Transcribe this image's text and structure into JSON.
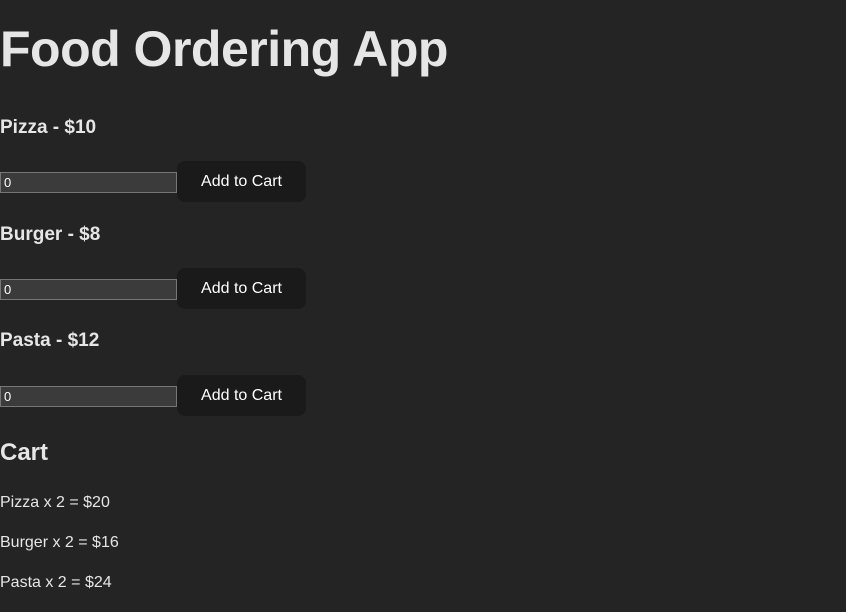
{
  "page": {
    "title": "Food Ordering App"
  },
  "menu": {
    "items": [
      {
        "heading": "Pizza - $10",
        "quantity": "0",
        "button_label": "Add to Cart"
      },
      {
        "heading": "Burger - $8",
        "quantity": "0",
        "button_label": "Add to Cart"
      },
      {
        "heading": "Pasta - $12",
        "quantity": "0",
        "button_label": "Add to Cart"
      }
    ]
  },
  "cart": {
    "heading": "Cart",
    "lines": [
      "Pizza x 2 = $20",
      "Burger x 2 = $16",
      "Pasta x 2 = $24"
    ]
  },
  "colors": {
    "background": "#242424",
    "text": "#e6e6e6",
    "button_background": "#1a1a1a",
    "input_background": "#3b3b3b"
  }
}
